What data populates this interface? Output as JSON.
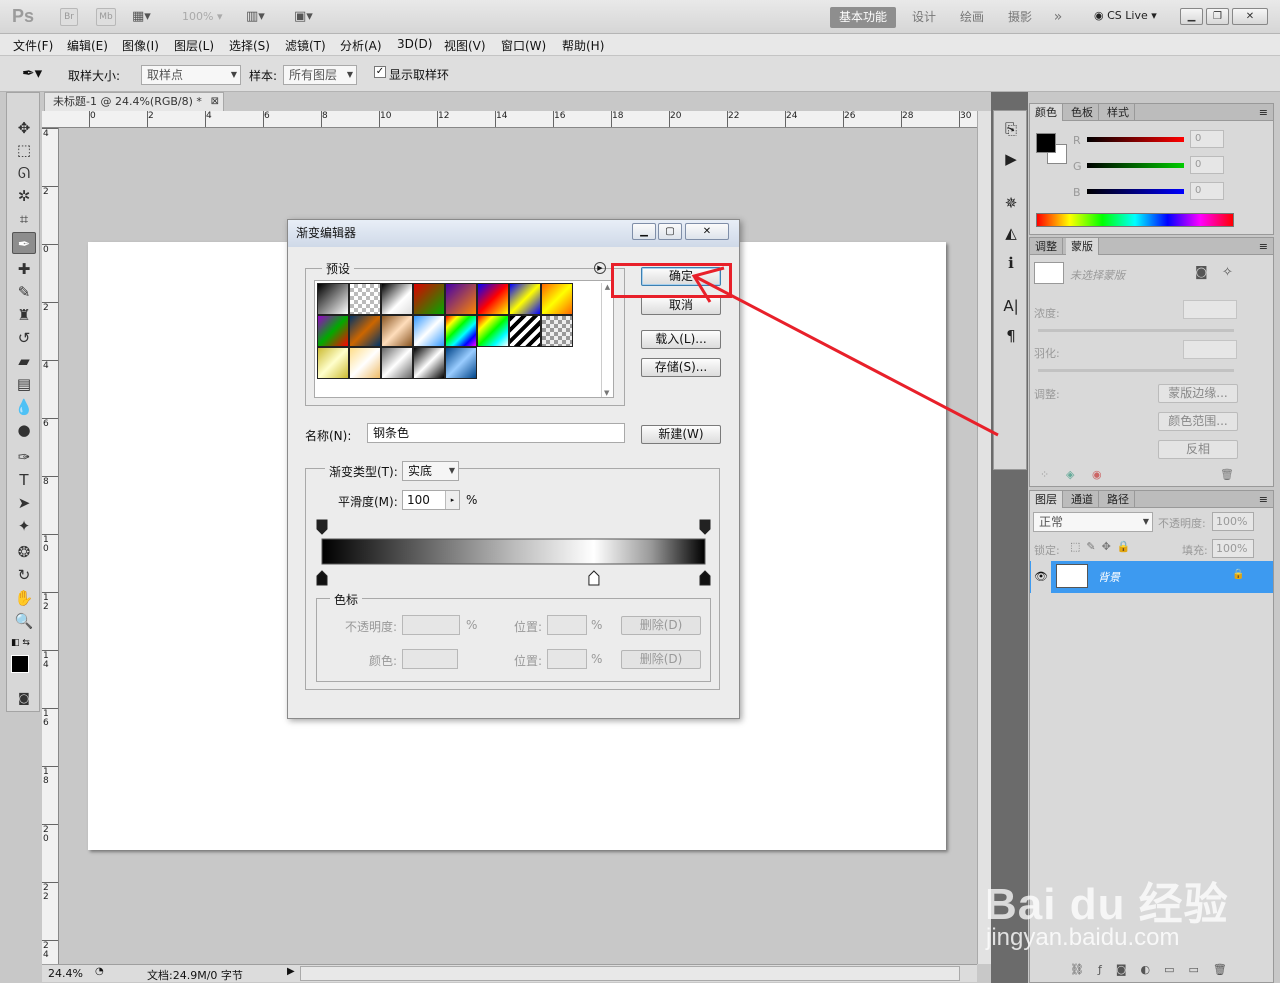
{
  "app": {
    "logo": "Ps",
    "zoom_display": "100%",
    "workspaces": [
      "基本功能",
      "设计",
      "绘画",
      "摄影"
    ],
    "more": "»",
    "cslive": "CS Live"
  },
  "menu": [
    "文件(F)",
    "编辑(E)",
    "图像(I)",
    "图层(L)",
    "选择(S)",
    "滤镜(T)",
    "分析(A)",
    "3D(D)",
    "视图(V)",
    "窗口(W)",
    "帮助(H)"
  ],
  "options": {
    "sample_size_label": "取样大小:",
    "sample_size_value": "取样点",
    "sample_label": "样本:",
    "sample_value": "所有图层",
    "show_ring": "显示取样环"
  },
  "document": {
    "tab_title": "未标题-1 @ 24.4%(RGB/8) *",
    "zoom": "24.4%",
    "doc_info": "文档:24.9M/0 字节"
  },
  "ruler": {
    "h": [
      "0",
      "2",
      "4",
      "6",
      "8",
      "10",
      "12",
      "14",
      "16",
      "18",
      "20",
      "22",
      "24",
      "26",
      "28",
      "30"
    ],
    "v": [
      "4",
      "2",
      "0",
      "2",
      "4",
      "6",
      "8",
      "1 0",
      "1 2",
      "1 4",
      "1 6",
      "1 8",
      "2 0",
      "2 2",
      "2 4"
    ]
  },
  "panels": {
    "color": {
      "tabs": [
        "颜色",
        "色板",
        "样式"
      ],
      "channels": [
        {
          "name": "R",
          "value": "0"
        },
        {
          "name": "G",
          "value": "0"
        },
        {
          "name": "B",
          "value": "0"
        }
      ]
    },
    "masks": {
      "tabs": [
        "调整",
        "蒙版"
      ],
      "no_mask": "未选择蒙版",
      "density": "浓度:",
      "feather": "羽化:",
      "refine": "调整:",
      "btn_edge": "蒙版边缘...",
      "btn_range": "颜色范围...",
      "btn_invert": "反相"
    },
    "layers": {
      "tabs": [
        "图层",
        "通道",
        "路径"
      ],
      "blend": "正常",
      "opacity_label": "不透明度:",
      "opacity": "100%",
      "lock_label": "锁定:",
      "fill_label": "填充:",
      "fill": "100%",
      "layer_name": "背景"
    }
  },
  "dialog": {
    "title": "渐变编辑器",
    "presets_label": "预设",
    "ok": "确定",
    "cancel": "取消",
    "load": "载入(L)...",
    "save": "存储(S)...",
    "name_label": "名称(N):",
    "name_value": "钢条色",
    "new": "新建(W)",
    "type_label": "渐变类型(T):",
    "type_value": "实底",
    "smooth_label": "平滑度(M):",
    "smooth_value": "100",
    "smooth_unit": "%",
    "stops_label": "色标",
    "opacity_label": "不透明度:",
    "opacity_unit": "%",
    "position_label": "位置:",
    "position_unit": "%",
    "delete": "删除(D)",
    "color_label": "颜色:",
    "gradient_stops": [
      0.0,
      0.0,
      0.71,
      1.0
    ]
  },
  "watermark": {
    "brand": "Bai du 经验",
    "url": "jingyan.baidu.com"
  },
  "colors": {
    "highlight": "#e8202a",
    "layer_selected": "#3d9af0",
    "accent": "#8e8e8e"
  }
}
